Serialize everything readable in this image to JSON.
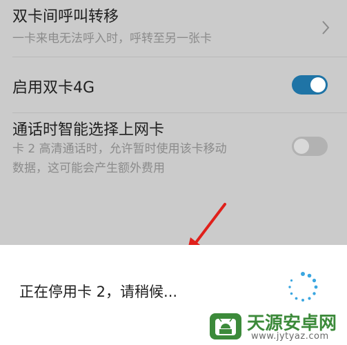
{
  "settings": {
    "call_forwarding": {
      "title": "双卡间呼叫转移",
      "subtitle": "一卡来电无法呼入时，呼转至另一张卡"
    },
    "dual_4g": {
      "title": "启用双卡4G",
      "enabled": true
    },
    "smart_data": {
      "title": "通话时智能选择上网卡",
      "subtitle_line1": "卡 2 高清通话时，允许暂时使用该卡移动",
      "subtitle_line2": "数据，这可能会产生额外费用",
      "enabled": false
    }
  },
  "dialog": {
    "message": "正在停用卡 2，请稍候..."
  },
  "watermark": {
    "title": "天源安卓网",
    "url": "www.jytyaz.com"
  },
  "colors": {
    "toggle_on": "#1f74a6",
    "arrow": "#e0201b",
    "spinner": "#3aa6e0",
    "watermark_green": "#3c8a3a"
  },
  "icons": {
    "chevron": "chevron-right-icon",
    "spinner": "loading-spinner-icon",
    "arrow": "red-arrow-annotation"
  }
}
